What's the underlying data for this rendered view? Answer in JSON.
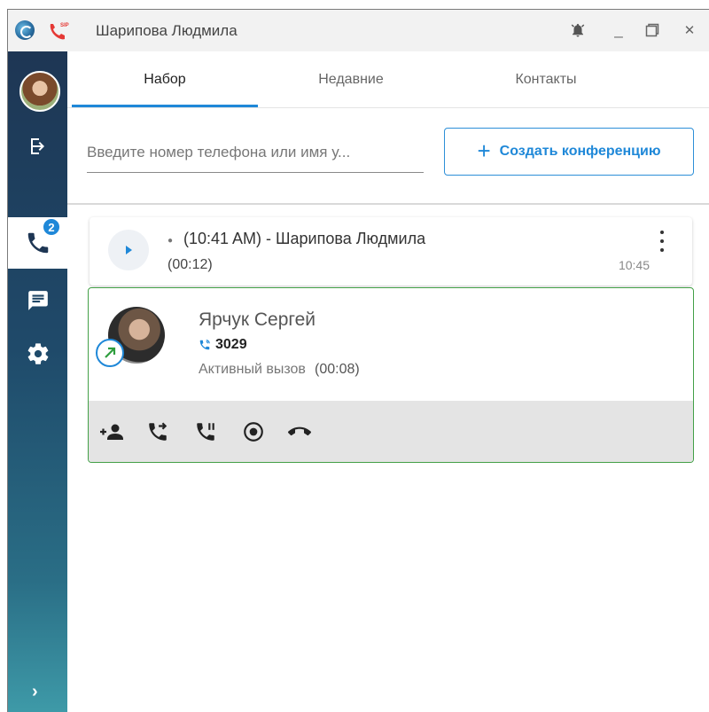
{
  "window": {
    "title": "Шарипова Людмила",
    "controls": {
      "minimize": "_",
      "close": "✕"
    }
  },
  "tabs": [
    {
      "label": "Набор",
      "active": true
    },
    {
      "label": "Недавние",
      "active": false
    },
    {
      "label": "Контакты",
      "active": false
    }
  ],
  "sidebar": {
    "calls_badge": "2",
    "expand": "›"
  },
  "search": {
    "placeholder": "Введите номер телефона или имя у..."
  },
  "conference_button": {
    "icon": "+",
    "label": "Создать конференцию"
  },
  "recording": {
    "dot": "●",
    "title": "(10:41 AM) - Шарипова Людмила",
    "duration": "(00:12)",
    "time": "10:45"
  },
  "active_call": {
    "name": "Ярчук Сергей",
    "extension": "3029",
    "status": "Активный вызов",
    "elapsed": "(00:08)"
  },
  "colors": {
    "accent": "#1f88d8",
    "active_call_border": "#43a047",
    "sip_icon": "#e53935"
  }
}
